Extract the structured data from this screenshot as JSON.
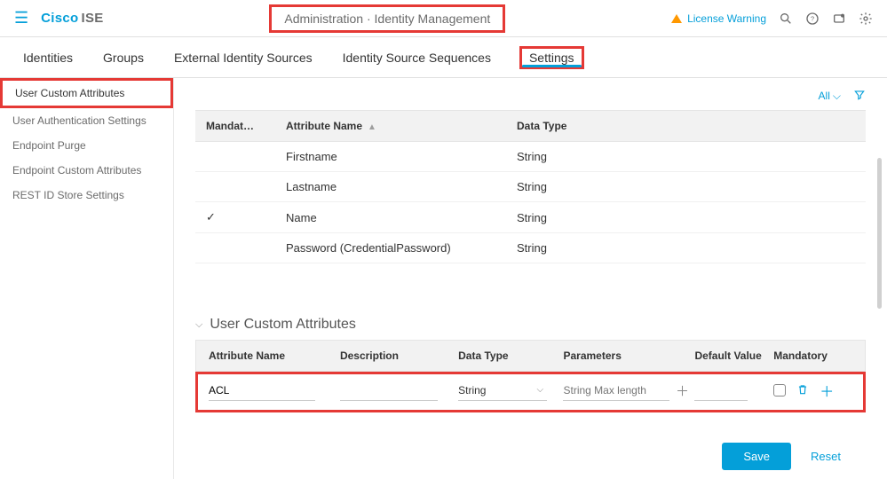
{
  "header": {
    "brand_cisco": "Cisco",
    "brand_ise": "ISE",
    "breadcrumb": "Administration · Identity Management",
    "license_text": "License Warning"
  },
  "tabs": [
    {
      "label": "Identities"
    },
    {
      "label": "Groups"
    },
    {
      "label": "External Identity Sources"
    },
    {
      "label": "Identity Source Sequences"
    },
    {
      "label": "Settings",
      "active": true
    }
  ],
  "sidebar": {
    "items": [
      {
        "label": "User Custom Attributes",
        "active": true
      },
      {
        "label": "User Authentication Settings"
      },
      {
        "label": "Endpoint Purge"
      },
      {
        "label": "Endpoint Custom Attributes"
      },
      {
        "label": "REST ID Store Settings"
      }
    ]
  },
  "filter": {
    "all": "All"
  },
  "table": {
    "columns": {
      "mandatory": "Mandat…",
      "attribute": "Attribute Name",
      "datatype": "Data Type"
    },
    "rows": [
      {
        "mandatory": "",
        "attr": "Firstname",
        "type": "String"
      },
      {
        "mandatory": "",
        "attr": "Lastname",
        "type": "String"
      },
      {
        "mandatory": "✓",
        "attr": "Name",
        "type": "String"
      },
      {
        "mandatory": "",
        "attr": "Password (CredentialPassword)",
        "type": "String"
      }
    ]
  },
  "section": {
    "title": "User Custom Attributes"
  },
  "uca": {
    "header": {
      "attr": "Attribute Name",
      "desc": "Description",
      "dt": "Data Type",
      "param": "Parameters",
      "def": "Default Value",
      "mand": "Mandatory"
    },
    "row": {
      "attr_value": "ACL",
      "desc_value": "",
      "dt_value": "String",
      "param_placeholder": "String Max length",
      "def_value": ""
    }
  },
  "buttons": {
    "save": "Save",
    "reset": "Reset"
  }
}
